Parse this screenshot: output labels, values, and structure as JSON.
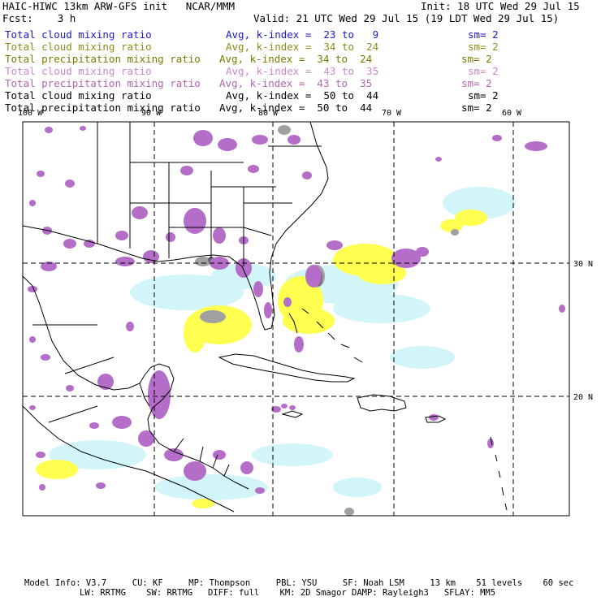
{
  "header": {
    "title": "HAIC-HIWC 13km ARW-GFS init   NCAR/MMM",
    "init": "Init: 18 UTC Wed 29 Jul 15",
    "fcst": "Fcst:    3 h",
    "valid": "Valid: 21 UTC Wed 29 Jul 15 (19 LDT Wed 29 Jul 15)"
  },
  "legend_rows": [
    {
      "field": "Total cloud mixing ratio",
      "stat": "Avg, k-index =  23 to   9",
      "sm": "sm= 2",
      "color": "#1a1acc"
    },
    {
      "field": "Total cloud mixing ratio",
      "stat": "Avg, k-index =  34 to  24",
      "sm": "sm= 2",
      "color": "#8c8c1a"
    },
    {
      "field": "Total precipitation mixing ratio",
      "stat": "Avg, k-index =  34 to  24",
      "sm": "sm= 2",
      "color": "#7a7a00"
    },
    {
      "field": "Total cloud mixing ratio",
      "stat": "Avg, k-index =  43 to  35",
      "sm": "sm= 2",
      "color": "#cc88cc"
    },
    {
      "field": "Total precipitation mixing ratio",
      "stat": "Avg, k-index =  43 to  35",
      "sm": "sm= 2",
      "color": "#b266b2"
    },
    {
      "field": "Total cloud mixing ratio",
      "stat": "Avg, k-index =  50 to  44",
      "sm": "sm= 2",
      "color": "#000000"
    },
    {
      "field": "Total precipitation mixing ratio",
      "stat": "Avg, k-index =  50 to  44",
      "sm": "sm= 2",
      "color": "#000000"
    }
  ],
  "grid_labels": {
    "lon": [
      "100 W",
      "90 W",
      "80 W",
      "70 W",
      "60 W"
    ],
    "lat": [
      "30 N",
      "20 N"
    ]
  },
  "footer": {
    "line1": "Model Info: V3.7     CU: KF     MP: Thompson     PBL: YSU     SF: Noah LSM     13 km    51 levels    60 sec",
    "line2": "LW: RRTMG    SW: RRTMG   DIFF: full    KM: 2D Smagor DAMP: Rayleigh3   SFLAY: MM5"
  },
  "colors": {
    "purple": "#b46ec8",
    "yellow": "#ffff50",
    "lightblue": "#d2f5fa",
    "gray": "#a0a0a0",
    "darkgray": "#646464"
  }
}
